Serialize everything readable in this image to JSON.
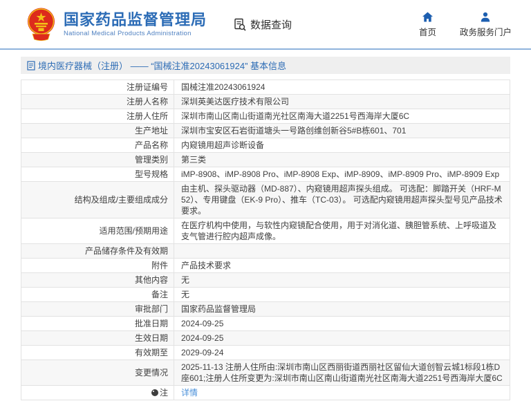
{
  "header": {
    "agency_name_zh": "国家药品监督管理局",
    "agency_name_en": "National Medical Products Administration",
    "data_query_label": "数据查询",
    "nav": [
      {
        "label": "首页",
        "icon": "home-icon"
      },
      {
        "label": "政务服务门户",
        "icon": "person-icon"
      }
    ]
  },
  "page_title": "境内医疗器械（注册） —— “国械注准20243061924” 基本信息",
  "colors": {
    "brand_blue": "#2c6cb6",
    "nav_icon_blue": "#1d5fb0",
    "link_blue": "#4a90d9",
    "emblem_red": "#dd2b1c",
    "emblem_gold": "#f2c118",
    "row_stripe": "#f7f7f7",
    "table_border": "#e2e2e2"
  },
  "table": {
    "rows": [
      {
        "label": "注册证编号",
        "value": "国械注准20243061924"
      },
      {
        "label": "注册人名称",
        "value": "深圳英美达医疗技术有限公司"
      },
      {
        "label": "注册人住所",
        "value": "深圳市南山区南山街道南光社区南海大道2251号西海岸大厦6C"
      },
      {
        "label": "生产地址",
        "value": "深圳市宝安区石岩街道塘头一号路创维创新谷5#B栋601、701"
      },
      {
        "label": "产品名称",
        "value": "内窥镜用超声诊断设备"
      },
      {
        "label": "管理类别",
        "value": "第三类"
      },
      {
        "label": "型号规格",
        "value": "iMP-8908、iMP-8908 Pro、iMP-8908 Exp、iMP-8909、iMP-8909 Pro、iMP-8909 Exp"
      },
      {
        "label": "结构及组成/主要组成成分",
        "value": "由主机、探头驱动器（MD-887）、内窥镜用超声探头组成。 可选配：脚踏开关（HRF-M52）、专用键盘（EK-9 Pro）、推车（TC-03）。 可选配内窥镜用超声探头型号见产品技术要求。"
      },
      {
        "label": "适用范围/预期用途",
        "value": "在医疗机构中使用，与软性内窥镜配合使用，用于对消化道、胰胆管系统、上呼吸道及支气管进行腔内超声成像。"
      },
      {
        "label": "产品储存条件及有效期",
        "value": ""
      },
      {
        "label": "附件",
        "value": "产品技术要求"
      },
      {
        "label": "其他内容",
        "value": "无"
      },
      {
        "label": "备注",
        "value": "无"
      },
      {
        "label": "审批部门",
        "value": "国家药品监督管理局"
      },
      {
        "label": "批准日期",
        "value": "2024-09-25"
      },
      {
        "label": "生效日期",
        "value": "2024-09-25"
      },
      {
        "label": "有效期至",
        "value": "2029-09-24"
      },
      {
        "label": "变更情况",
        "value": "2025-11-13 注册人住所由:深圳市南山区西丽街道西丽社区留仙大道创智云城1标段1栋D座601;注册人住所变更为:深圳市南山区南山街道南光社区南海大道2251号西海岸大厦6C"
      },
      {
        "label": "注",
        "value": "详情"
      }
    ]
  }
}
